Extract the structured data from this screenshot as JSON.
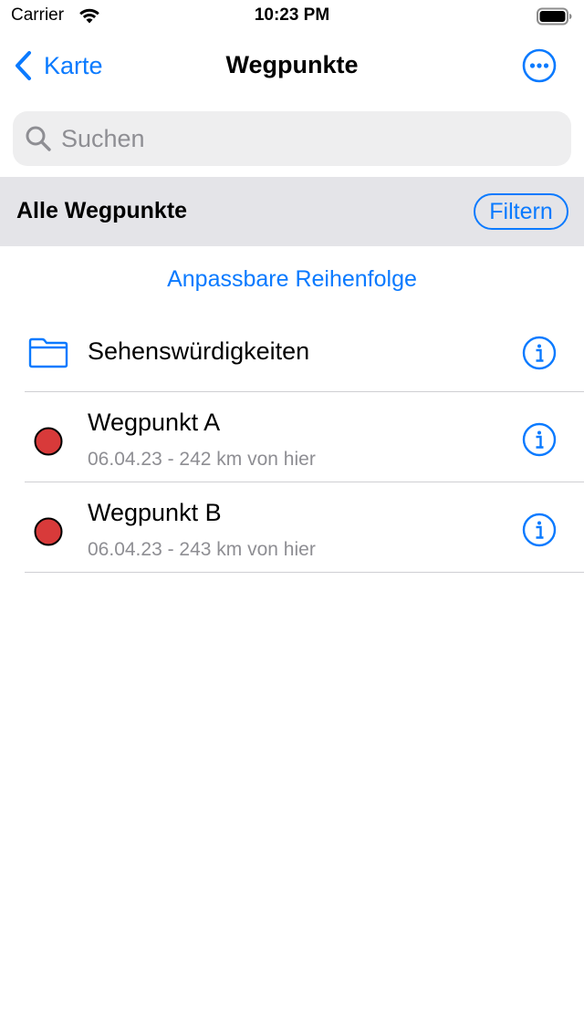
{
  "status_bar": {
    "carrier": "Carrier",
    "time": "10:23 PM"
  },
  "nav": {
    "back_label": "Karte",
    "title": "Wegpunkte"
  },
  "search": {
    "placeholder": "Suchen",
    "value": ""
  },
  "section": {
    "title": "Alle Wegpunkte",
    "filter_label": "Filtern"
  },
  "sort_link": "Anpassbare Reihenfolge",
  "list": {
    "folder": {
      "label": "Sehenswürdigkeiten",
      "icon": "folder-icon"
    },
    "waypoints": [
      {
        "title": "Wegpunkt A",
        "subtitle": "06.04.23 - 242 km von hier",
        "marker_color": "#d83a3a"
      },
      {
        "title": "Wegpunkt B",
        "subtitle": "06.04.23 - 243 km von hier",
        "marker_color": "#d83a3a"
      }
    ]
  },
  "colors": {
    "accent": "#0a7aff",
    "marker": "#d83a3a",
    "section_bg": "#e4e4e8",
    "search_bg": "#eeeeef",
    "secondary_text": "#8e8e93"
  }
}
